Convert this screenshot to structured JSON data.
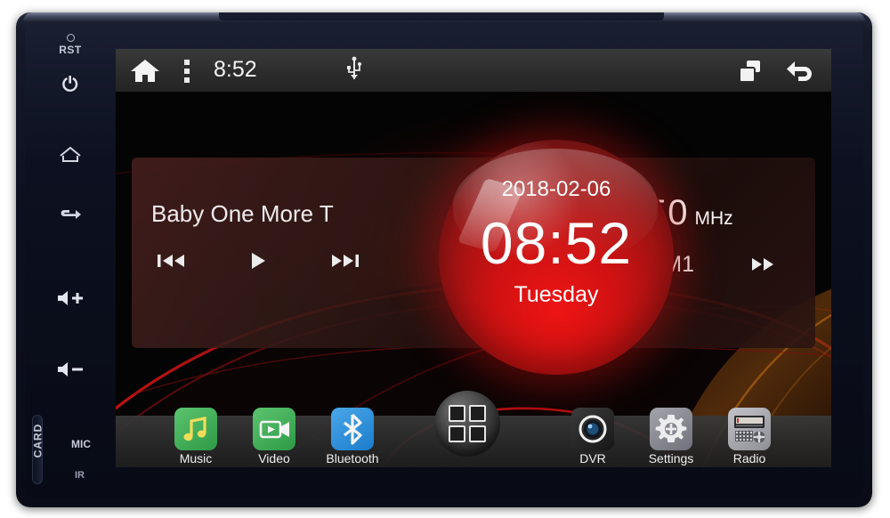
{
  "device": {
    "bezel": {
      "reset_label": "RST",
      "power_icon": "power-icon",
      "home_icon": "home-outline-icon",
      "return_icon": "return-arrow-icon",
      "volume_up_icon": "volume-up-icon",
      "volume_down_icon": "volume-down-icon",
      "card_slot_label": "CARD",
      "mic_label": "MIC",
      "ir_label": "IR"
    }
  },
  "statusbar": {
    "home_icon": "home-icon",
    "menu_icon": "kebab-menu-icon",
    "time": "8:52",
    "usb_icon": "usb-icon",
    "recent_icon": "recent-apps-icon",
    "back_icon": "back-icon"
  },
  "widgets": {
    "media": {
      "title": "Baby One More T",
      "prev_icon": "skip-previous-icon",
      "play_icon": "play-icon",
      "next_icon": "skip-next-icon"
    },
    "clock": {
      "date": "2018-02-06",
      "time": "08:52",
      "day": "Tuesday"
    },
    "radio": {
      "frequency": "87.50",
      "unit": "MHz",
      "seek_down_icon": "seek-down-icon",
      "band": "FM1",
      "seek_up_icon": "seek-up-icon"
    }
  },
  "dock": {
    "items": [
      {
        "label": "Music",
        "icon": "music-note-icon",
        "color": "#3fae55"
      },
      {
        "label": "Video",
        "icon": "video-camera-icon",
        "color": "#3fae55"
      },
      {
        "label": "Bluetooth",
        "icon": "bluetooth-icon",
        "color": "#2a8fe0"
      },
      {
        "label": "DVR",
        "icon": "camera-lens-icon",
        "color": "#2b2b2b"
      },
      {
        "label": "Settings",
        "icon": "gear-icon",
        "color": "#8d8d93"
      },
      {
        "label": "Radio",
        "icon": "radio-icon",
        "color": "#a8a8ad"
      }
    ],
    "app_drawer_icon": "app-grid-icon"
  },
  "colors": {
    "accent_red": "#cf1212",
    "status_bar": "#2c2c2c",
    "bezel": "#0d1020"
  }
}
